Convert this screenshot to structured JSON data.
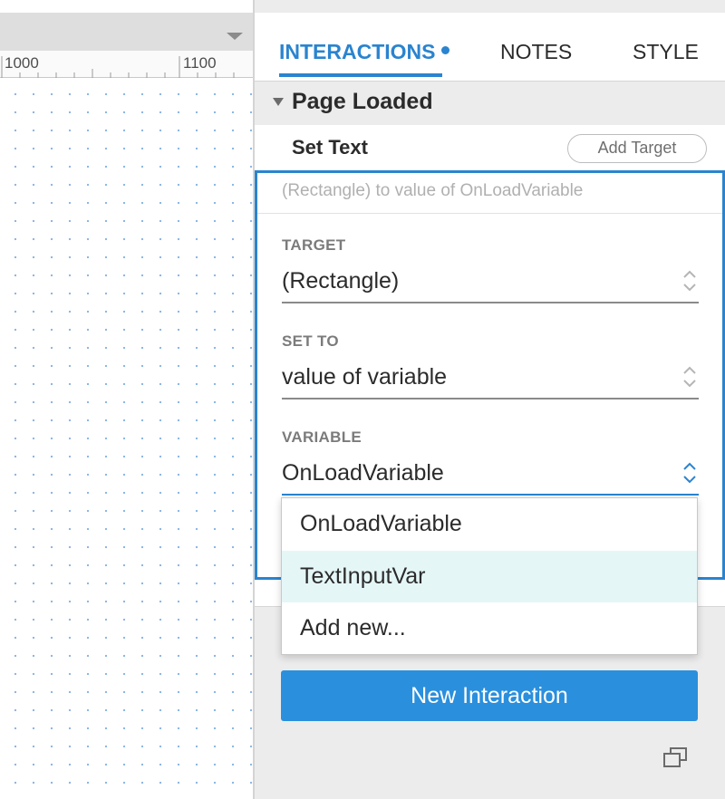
{
  "ruler": {
    "labels": [
      "1000",
      "1100"
    ]
  },
  "tabs": [
    {
      "label": "INTERACTIONS",
      "active": true,
      "has_indicator_dot": true
    },
    {
      "label": "NOTES",
      "active": false
    },
    {
      "label": "STYLE",
      "active": false
    }
  ],
  "event": {
    "title": "Page Loaded"
  },
  "action": {
    "title": "Set Text",
    "add_target_label": "Add Target",
    "summary": "(Rectangle) to value of OnLoadVariable",
    "fields": {
      "target": {
        "label": "TARGET",
        "value": "(Rectangle)"
      },
      "set_to": {
        "label": "SET TO",
        "value": "value of variable"
      },
      "variable": {
        "label": "VARIABLE",
        "value": "OnLoadVariable"
      }
    }
  },
  "dropdown": {
    "options": [
      "OnLoadVariable",
      "TextInputVar",
      "Add new..."
    ],
    "highlighted_index": 1
  },
  "new_interaction_label": "New Interaction",
  "colors": {
    "accent": "#2a84cf",
    "button_bg": "#2a8fdd",
    "highlight": "#e5f6f7",
    "grid_dot": "#8fb7e3"
  },
  "icons": {
    "tab_dropdown": "chevron-down-icon",
    "event_caret": "caret-down-icon",
    "select_stepper": "up-down-chevron-icon",
    "popout": "popout-window-icon"
  }
}
